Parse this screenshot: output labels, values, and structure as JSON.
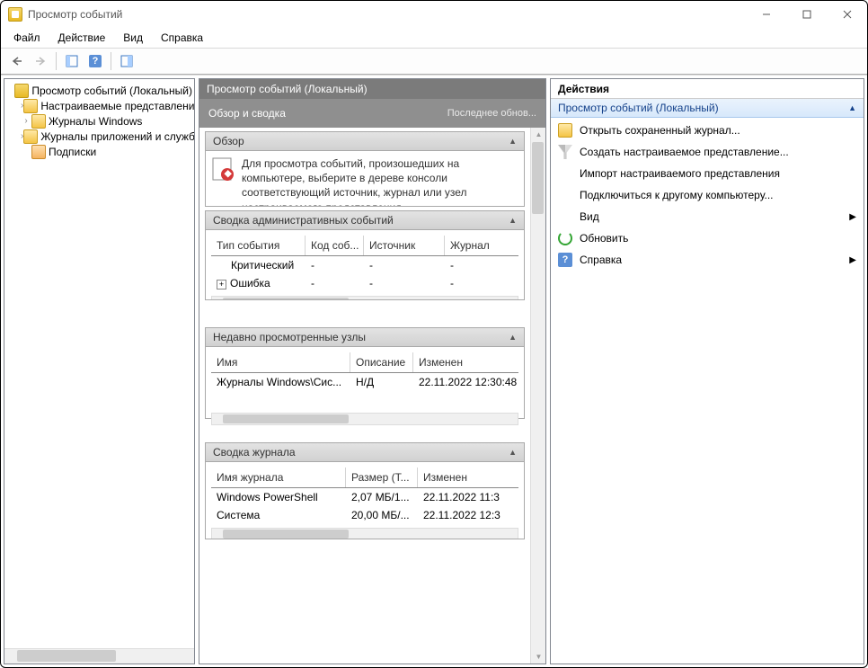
{
  "window": {
    "title": "Просмотр событий"
  },
  "menu": {
    "file": "Файл",
    "action": "Действие",
    "view": "Вид",
    "help": "Справка"
  },
  "tree": {
    "root": "Просмотр событий (Локальный)",
    "items": [
      "Настраиваемые представления",
      "Журналы Windows",
      "Журналы приложений и служб",
      "Подписки"
    ]
  },
  "center": {
    "header": "Просмотр событий (Локальный)",
    "title": "Обзор и сводка",
    "updated": "Последнее обнов...",
    "overview_label": "Обзор",
    "overview_text": "Для просмотра событий, произошедших на компьютере, выберите в дереве консоли соответствующий источник, журнал или узел настраиваемого представления.",
    "admin_label": "Сводка административных событий",
    "admin_cols": [
      "Тип события",
      "Код соб...",
      "Источник",
      "Журнал"
    ],
    "admin_rows": [
      {
        "type": "Критический",
        "code": "-",
        "src": "-",
        "log": "-"
      },
      {
        "type": "Ошибка",
        "code": "-",
        "src": "-",
        "log": "-",
        "expandable": true
      }
    ],
    "recent_label": "Недавно просмотренные узлы",
    "recent_cols": [
      "Имя",
      "Описание",
      "Изменен"
    ],
    "recent_rows": [
      {
        "name": "Журналы Windows\\Сис...",
        "desc": "Н/Д",
        "mod": "22.11.2022 12:30:48"
      }
    ],
    "summary_label": "Сводка журнала",
    "summary_cols": [
      "Имя журнала",
      "Размер (Т...",
      "Изменен"
    ],
    "summary_rows": [
      {
        "name": "Windows PowerShell",
        "size": "2,07 МБ/1...",
        "mod": "22.11.2022 11:3"
      },
      {
        "name": "Система",
        "size": "20,00 МБ/...",
        "mod": "22.11.2022 12:3"
      }
    ]
  },
  "actions": {
    "title": "Действия",
    "group": "Просмотр событий (Локальный)",
    "items": [
      {
        "icon": "folder",
        "label": "Открыть сохраненный журнал..."
      },
      {
        "icon": "filter",
        "label": "Создать настраиваемое представление..."
      },
      {
        "icon": "none",
        "label": "Импорт настраиваемого представления"
      },
      {
        "icon": "none",
        "label": "Подключиться к другому компьютеру..."
      },
      {
        "icon": "none",
        "label": "Вид",
        "submenu": true
      },
      {
        "icon": "refresh",
        "label": "Обновить"
      },
      {
        "icon": "help",
        "label": "Справка",
        "submenu": true
      }
    ]
  }
}
